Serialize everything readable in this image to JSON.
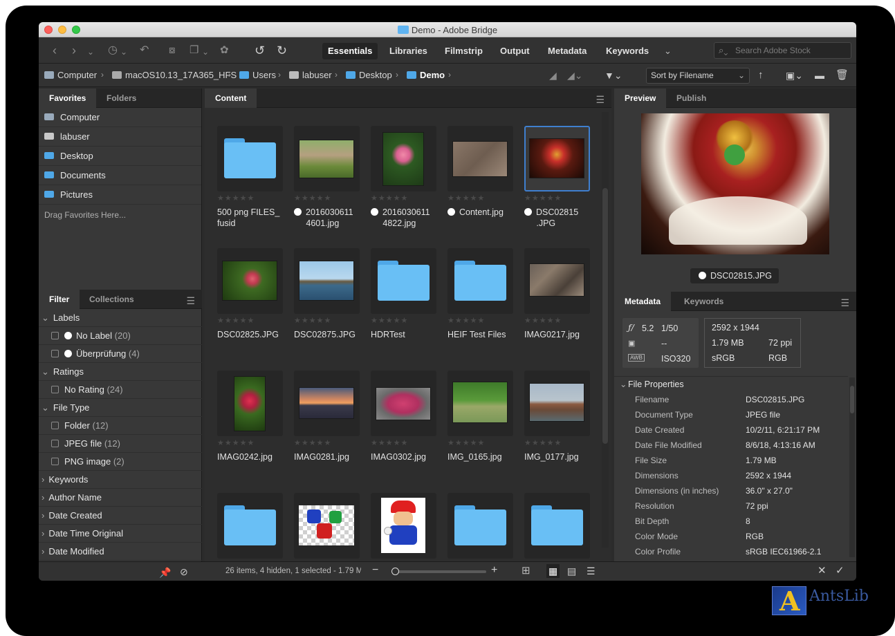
{
  "window": {
    "title": "Demo - Adobe Bridge"
  },
  "workspaces": [
    "Essentials",
    "Libraries",
    "Filmstrip",
    "Output",
    "Metadata",
    "Keywords"
  ],
  "search": {
    "placeholder": "Search Adobe Stock"
  },
  "path": {
    "items": [
      "Computer",
      "macOS10.13_17A365_HFS",
      "Users",
      "labuser",
      "Desktop",
      "Demo"
    ]
  },
  "sort": {
    "label": "Sort by Filename"
  },
  "left_tabs": [
    "Favorites",
    "Folders"
  ],
  "favorites": [
    "Computer",
    "labuser",
    "Desktop",
    "Documents",
    "Pictures"
  ],
  "drag_hint": "Drag Favorites Here...",
  "filter_tabs": [
    "Filter",
    "Collections"
  ],
  "filter": {
    "labels_head": "Labels",
    "no_label": "No Label",
    "no_label_count": "(20)",
    "ueberpruefung": "Überprüfung",
    "ueberpruefung_count": "(4)",
    "ratings_head": "Ratings",
    "no_rating": "No Rating",
    "no_rating_count": "(24)",
    "filetype_head": "File Type",
    "folder": "Folder",
    "folder_count": "(12)",
    "jpeg": "JPEG file",
    "jpeg_count": "(12)",
    "png": "PNG image",
    "png_count": "(2)",
    "keywords": "Keywords",
    "author": "Author Name",
    "date_created": "Date Created",
    "date_time_original": "Date Time Original",
    "date_modified": "Date Modified"
  },
  "content": {
    "tab": "Content",
    "items": [
      {
        "name1": "500 png FILES_",
        "name2": "fusid"
      },
      {
        "name1": "2016030611",
        "name2": "4601.jpg"
      },
      {
        "name1": "2016030611",
        "name2": "4822.jpg"
      },
      {
        "name1": "Content.jpg",
        "name2": ""
      },
      {
        "name1": "DSC02815",
        "name2": ".JPG"
      },
      {
        "name1": "DSC02825.JPG",
        "name2": ""
      },
      {
        "name1": "DSC02875.JPG",
        "name2": ""
      },
      {
        "name1": "HDRTest",
        "name2": ""
      },
      {
        "name1": "HEIF Test Files",
        "name2": ""
      },
      {
        "name1": "IMAG0217.jpg",
        "name2": ""
      },
      {
        "name1": "IMAG0242.jpg",
        "name2": ""
      },
      {
        "name1": "IMAG0281.jpg",
        "name2": ""
      },
      {
        "name1": "IMAG0302.jpg",
        "name2": ""
      },
      {
        "name1": "IMG_0165.jpg",
        "name2": ""
      },
      {
        "name1": "IMG_0177.jpg",
        "name2": ""
      }
    ]
  },
  "status": {
    "text": "26 items, 4 hidden, 1 selected - 1.79 M"
  },
  "preview": {
    "tabs": [
      "Preview",
      "Publish"
    ],
    "filename": "DSC02815.JPG"
  },
  "meta_tabs": [
    "Metadata",
    "Keywords"
  ],
  "exif": {
    "fstop": "5.2",
    "shutter": "1/50",
    "meter": "--",
    "iso_label": "ISO",
    "iso": "320",
    "awb": "AWB",
    "dims": "2592 x 1944",
    "size": "1.79 MB",
    "ppi": "72 ppi",
    "profile": "sRGB",
    "mode": "RGB"
  },
  "file_properties": {
    "head": "File Properties",
    "rows": [
      {
        "k": "Filename",
        "v": "DSC02815.JPG"
      },
      {
        "k": "Document Type",
        "v": "JPEG file"
      },
      {
        "k": "Date Created",
        "v": "10/2/11, 6:21:17 PM"
      },
      {
        "k": "Date File Modified",
        "v": "8/6/18, 4:13:16 AM"
      },
      {
        "k": "File Size",
        "v": "1.79 MB"
      },
      {
        "k": "Dimensions",
        "v": "2592 x 1944"
      },
      {
        "k": "Dimensions (in inches)",
        "v": "36.0\" x 27.0\""
      },
      {
        "k": "Resolution",
        "v": "72 ppi"
      },
      {
        "k": "Bit Depth",
        "v": "8"
      },
      {
        "k": "Color Mode",
        "v": "RGB"
      },
      {
        "k": "Color Profile",
        "v": "sRGB IEC61966-2.1"
      }
    ]
  },
  "watermark": {
    "text": "AntsLib"
  },
  "colors": {
    "accent": "#3f7fcf",
    "folder": "#69bff5",
    "panel": "#383838",
    "bg": "#2b2b2b"
  }
}
